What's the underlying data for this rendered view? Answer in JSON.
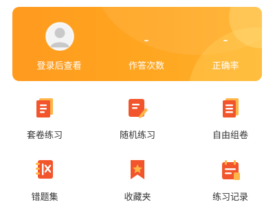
{
  "header": {
    "login_label": "登录后查看",
    "attempts_value": "-",
    "attempts_label": "作答次数",
    "accuracy_value": "-",
    "accuracy_label": "正确率"
  },
  "modes": [
    {
      "label": "套卷练习",
      "icon": "document-icon"
    },
    {
      "label": "随机练习",
      "icon": "edit-note-icon"
    },
    {
      "label": "自由组卷",
      "icon": "stacked-papers-icon"
    },
    {
      "label": "错题集",
      "icon": "wrong-book-icon"
    },
    {
      "label": "收藏夹",
      "icon": "bookmark-star-icon"
    },
    {
      "label": "练习记录",
      "icon": "record-clipboard-icon"
    }
  ],
  "colors": {
    "accent": "#ff9d1f",
    "icon_red": "#f2552c",
    "icon_orange": "#ffb547"
  }
}
